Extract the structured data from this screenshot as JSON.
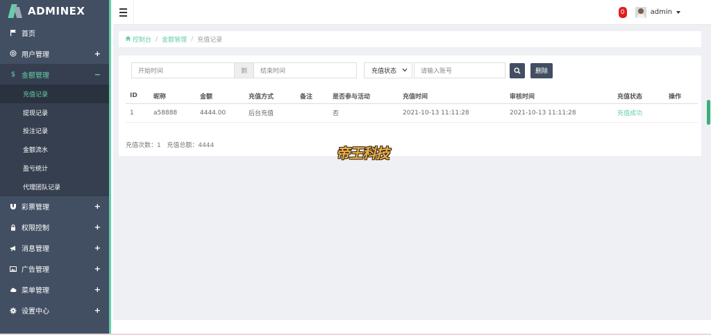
{
  "app": {
    "logo_text": "ADMINEX"
  },
  "colors": {
    "accent": "#65cea7",
    "sidebar_bg": "#424f63",
    "badge_red": "#e11d1d",
    "button_dark": "#424f63"
  },
  "sidebar": {
    "items": [
      {
        "label": "首页",
        "icon": "flag-icon",
        "expandable": false
      },
      {
        "label": "用户管理",
        "icon": "user-circle-icon",
        "expandable": true
      },
      {
        "label": "金额管理",
        "icon": "dollar-icon",
        "expandable": true,
        "active": true,
        "children": [
          "充值记录",
          "提现记录",
          "投注记录",
          "金额流水",
          "盈亏统计",
          "代理团队记录"
        ],
        "active_child": "充值记录"
      },
      {
        "label": "彩票管理",
        "icon": "magnet-icon",
        "expandable": true
      },
      {
        "label": "权限控制",
        "icon": "lock-icon",
        "expandable": true
      },
      {
        "label": "消息管理",
        "icon": "bullhorn-icon",
        "expandable": true
      },
      {
        "label": "广告管理",
        "icon": "image-icon",
        "expandable": true
      },
      {
        "label": "菜单管理",
        "icon": "cloud-icon",
        "expandable": true
      },
      {
        "label": "设置中心",
        "icon": "gear-icon",
        "expandable": true
      }
    ],
    "expand_symbol": "+",
    "collapse_symbol": "−"
  },
  "header": {
    "notification_count": "0",
    "user_name": "admin"
  },
  "breadcrumb": {
    "home": "控制台",
    "section": "金额管理",
    "current": "充值记录",
    "separator": "/"
  },
  "filters": {
    "start_placeholder": "开始时间",
    "to_label": "到",
    "end_placeholder": "结束时间",
    "status_select": "充值状态",
    "account_placeholder": "请输入账号",
    "delete_label": "删除"
  },
  "table": {
    "headers": [
      "ID",
      "昵称",
      "金额",
      "充值方式",
      "备注",
      "是否参与活动",
      "充值时间",
      "审核时间",
      "充值状态",
      "操作"
    ],
    "rows": [
      {
        "id": "1",
        "nickname": "a58888",
        "amount": "4444.00",
        "method": "后台充值",
        "note": "",
        "activity": "否",
        "recharge_time": "2021-10-13 11:11:28",
        "review_time": "2021-10-13 11:11:28",
        "status": "充值成功",
        "action": ""
      }
    ]
  },
  "summary": {
    "count_label": "充值次数：",
    "count": "1",
    "total_label": "充值总额：",
    "total": "4444"
  },
  "watermark": {
    "text": "帝王科技"
  }
}
